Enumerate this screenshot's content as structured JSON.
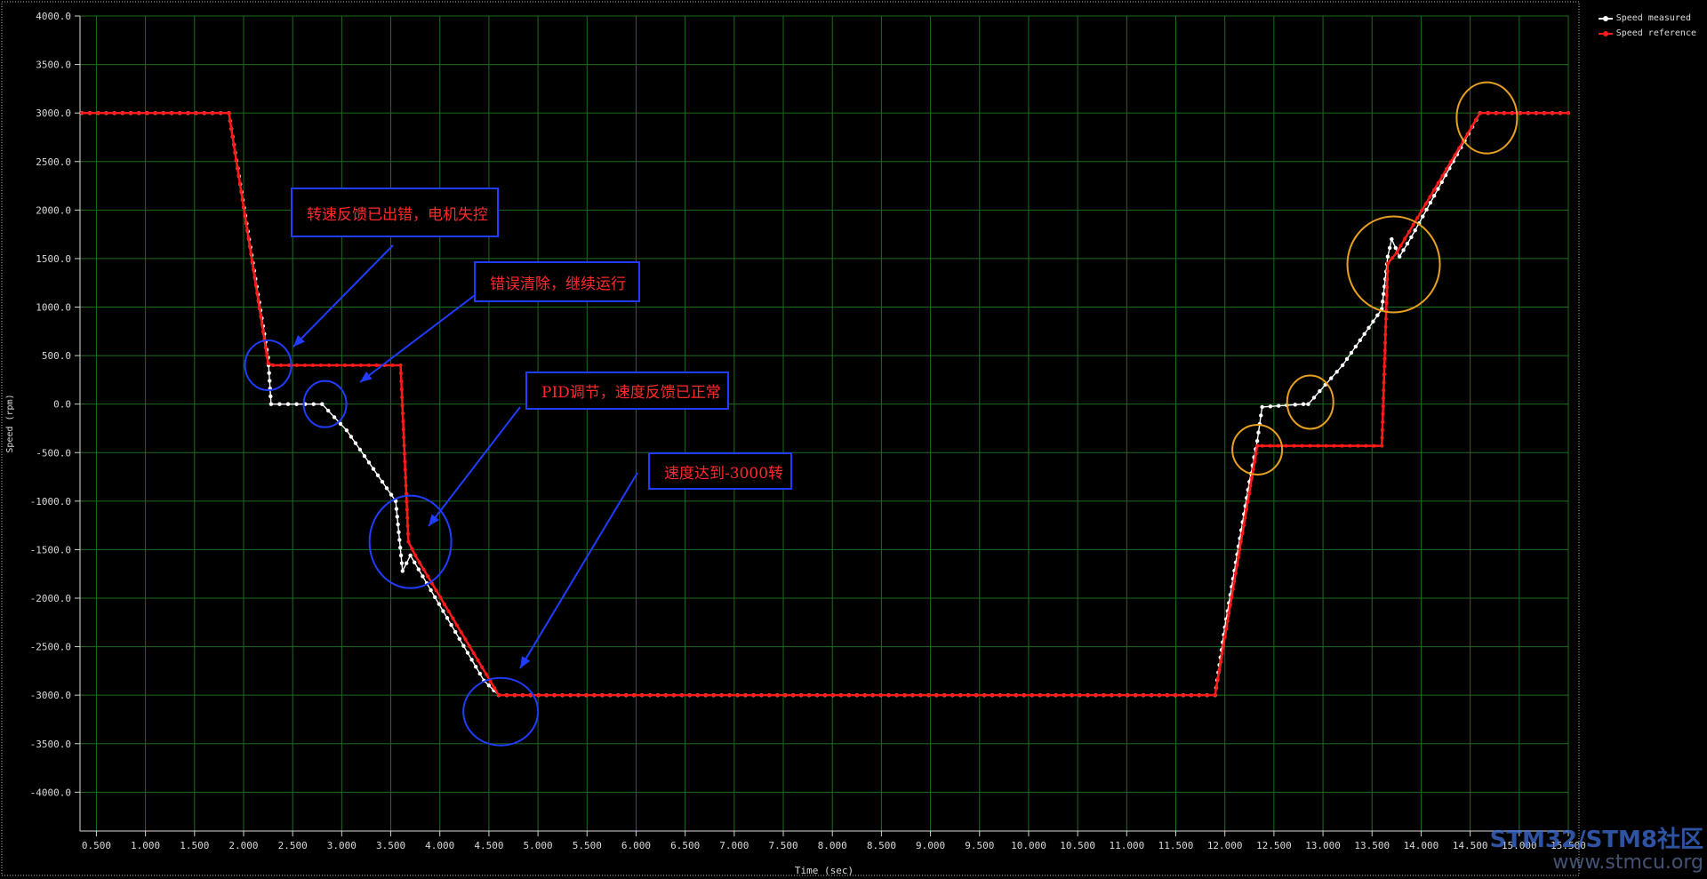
{
  "chart_data": {
    "type": "line",
    "title": "",
    "xlabel": "Time (sec)",
    "ylabel": "Speed (rpm)",
    "xlim": [
      0.333,
      15.5
    ],
    "ylim": [
      -4400,
      4000
    ],
    "x_ticks": [
      "0.500",
      "1.000",
      "1.500",
      "2.000",
      "2.500",
      "3.000",
      "3.500",
      "4.000",
      "4.500",
      "5.000",
      "5.500",
      "6.000",
      "6.500",
      "7.000",
      "7.500",
      "8.000",
      "8.500",
      "9.000",
      "9.500",
      "10.000",
      "10.500",
      "11.000",
      "11.500",
      "12.000",
      "12.500",
      "13.000",
      "13.500",
      "14.000",
      "14.500",
      "15.000",
      "15.500"
    ],
    "y_ticks": [
      "4000.0",
      "3500.0",
      "3000.0",
      "2500.0",
      "2000.0",
      "1500.0",
      "1000.0",
      "500.0",
      "0.0",
      "-500.0",
      "-1000.0",
      "-1500.0",
      "-2000.0",
      "-2500.0",
      "-3000.0",
      "-3500.0",
      "-4000.0"
    ],
    "grid": true,
    "legend_position": "top-right",
    "series": [
      {
        "name": "Speed measured",
        "color": "#ffffff",
        "points": [
          [
            0.35,
            3000
          ],
          [
            1.85,
            3000
          ],
          [
            2.25,
            480
          ],
          [
            2.28,
            0
          ],
          [
            2.8,
            0
          ],
          [
            3.05,
            -270
          ],
          [
            3.55,
            -1000
          ],
          [
            3.62,
            -1720
          ],
          [
            3.7,
            -1560
          ],
          [
            4.45,
            -2850
          ],
          [
            4.6,
            -3000
          ],
          [
            11.9,
            -3000
          ],
          [
            12.0,
            -2300
          ],
          [
            12.25,
            -800
          ],
          [
            12.33,
            -380
          ],
          [
            12.38,
            -30
          ],
          [
            12.8,
            0
          ],
          [
            12.85,
            0
          ],
          [
            13.2,
            400
          ],
          [
            13.6,
            980
          ],
          [
            13.66,
            1520
          ],
          [
            13.7,
            1700
          ],
          [
            13.78,
            1520
          ],
          [
            13.9,
            1720
          ],
          [
            14.6,
            3000
          ],
          [
            15.5,
            3000
          ]
        ]
      },
      {
        "name": "Speed reference",
        "color": "#ff1a1a",
        "points": [
          [
            0.35,
            3000
          ],
          [
            1.85,
            3000
          ],
          [
            2.25,
            420
          ],
          [
            2.3,
            400
          ],
          [
            3.6,
            400
          ],
          [
            3.68,
            -1420
          ],
          [
            3.75,
            -1560
          ],
          [
            4.6,
            -3000
          ],
          [
            11.9,
            -3000
          ],
          [
            12.0,
            -2400
          ],
          [
            12.33,
            -430
          ],
          [
            12.38,
            -430
          ],
          [
            13.6,
            -430
          ],
          [
            13.66,
            1450
          ],
          [
            13.75,
            1560
          ],
          [
            14.6,
            3000
          ],
          [
            15.5,
            3000
          ]
        ]
      }
    ],
    "annotations": [
      {
        "text": "转速反馈已出错，电机失控",
        "box_color": "#1f3cff",
        "text_color": "#ff2a2a"
      },
      {
        "text": "错误清除，继续运行",
        "box_color": "#1f3cff",
        "text_color": "#ff2a2a"
      },
      {
        "text": "PID调节，速度反馈已正常",
        "box_color": "#1f3cff",
        "text_color": "#ff2a2a"
      },
      {
        "text": "速度达到-3000转",
        "box_color": "#1f3cff",
        "text_color": "#ff2a2a"
      }
    ],
    "highlights": [
      {
        "x": 2.25,
        "y": 400,
        "color": "#1f3cff"
      },
      {
        "x": 2.83,
        "y": 0,
        "color": "#1f3cff"
      },
      {
        "x": 3.7,
        "y": -1420,
        "color": "#1f3cff"
      },
      {
        "x": 4.62,
        "y": -3170,
        "color": "#1f3cff"
      },
      {
        "x": 12.33,
        "y": -470,
        "color": "#e8a020"
      },
      {
        "x": 12.87,
        "y": 20,
        "color": "#e8a020"
      },
      {
        "x": 13.72,
        "y": 1440,
        "color": "#e8a020"
      },
      {
        "x": 14.67,
        "y": 2950,
        "color": "#e8a020"
      }
    ]
  },
  "watermark": {
    "line1": "STM32/STM8社区",
    "line2": "www.stmcu.org"
  }
}
